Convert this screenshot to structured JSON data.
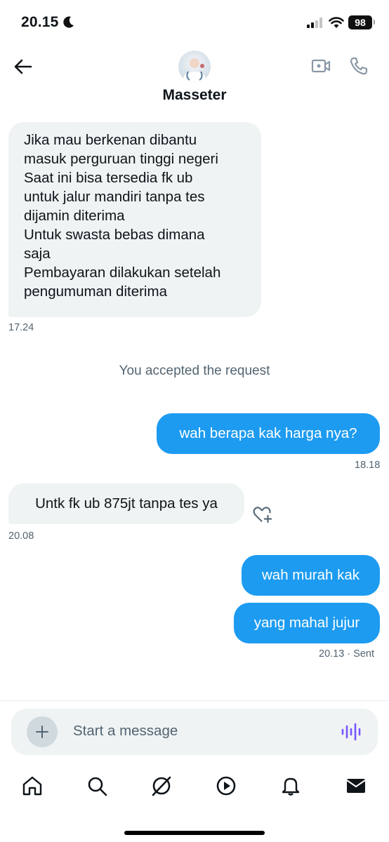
{
  "status_bar": {
    "time": "20.15",
    "battery": "98"
  },
  "header": {
    "title": "Masseter"
  },
  "messages": [
    {
      "text": "Jika mau berkenan dibantu\nmasuk perguruan tinggi negeri\nSaat ini bisa tersedia fk ub\nuntuk jalur mandiri tanpa tes\ndijamin diterima\nUntuk swasta bebas dimana\nsaja\nPembayaran dilakukan setelah\npengumuman diterima",
      "time": "17.24"
    },
    {
      "system": "You accepted the request"
    },
    {
      "text": "wah berapa kak harga nya?",
      "time": "18.18"
    },
    {
      "text": "Untk fk ub 875jt tanpa tes ya",
      "time": "20.08"
    },
    {
      "text": "wah murah kak"
    },
    {
      "text": "yang mahal jujur",
      "time": "20.13 · Sent"
    }
  ],
  "composer": {
    "placeholder": "Start a message"
  },
  "colors": {
    "accent": "#1d9bf0",
    "received_bubble": "#eff3f4",
    "voice_icon": "#7856ff"
  }
}
